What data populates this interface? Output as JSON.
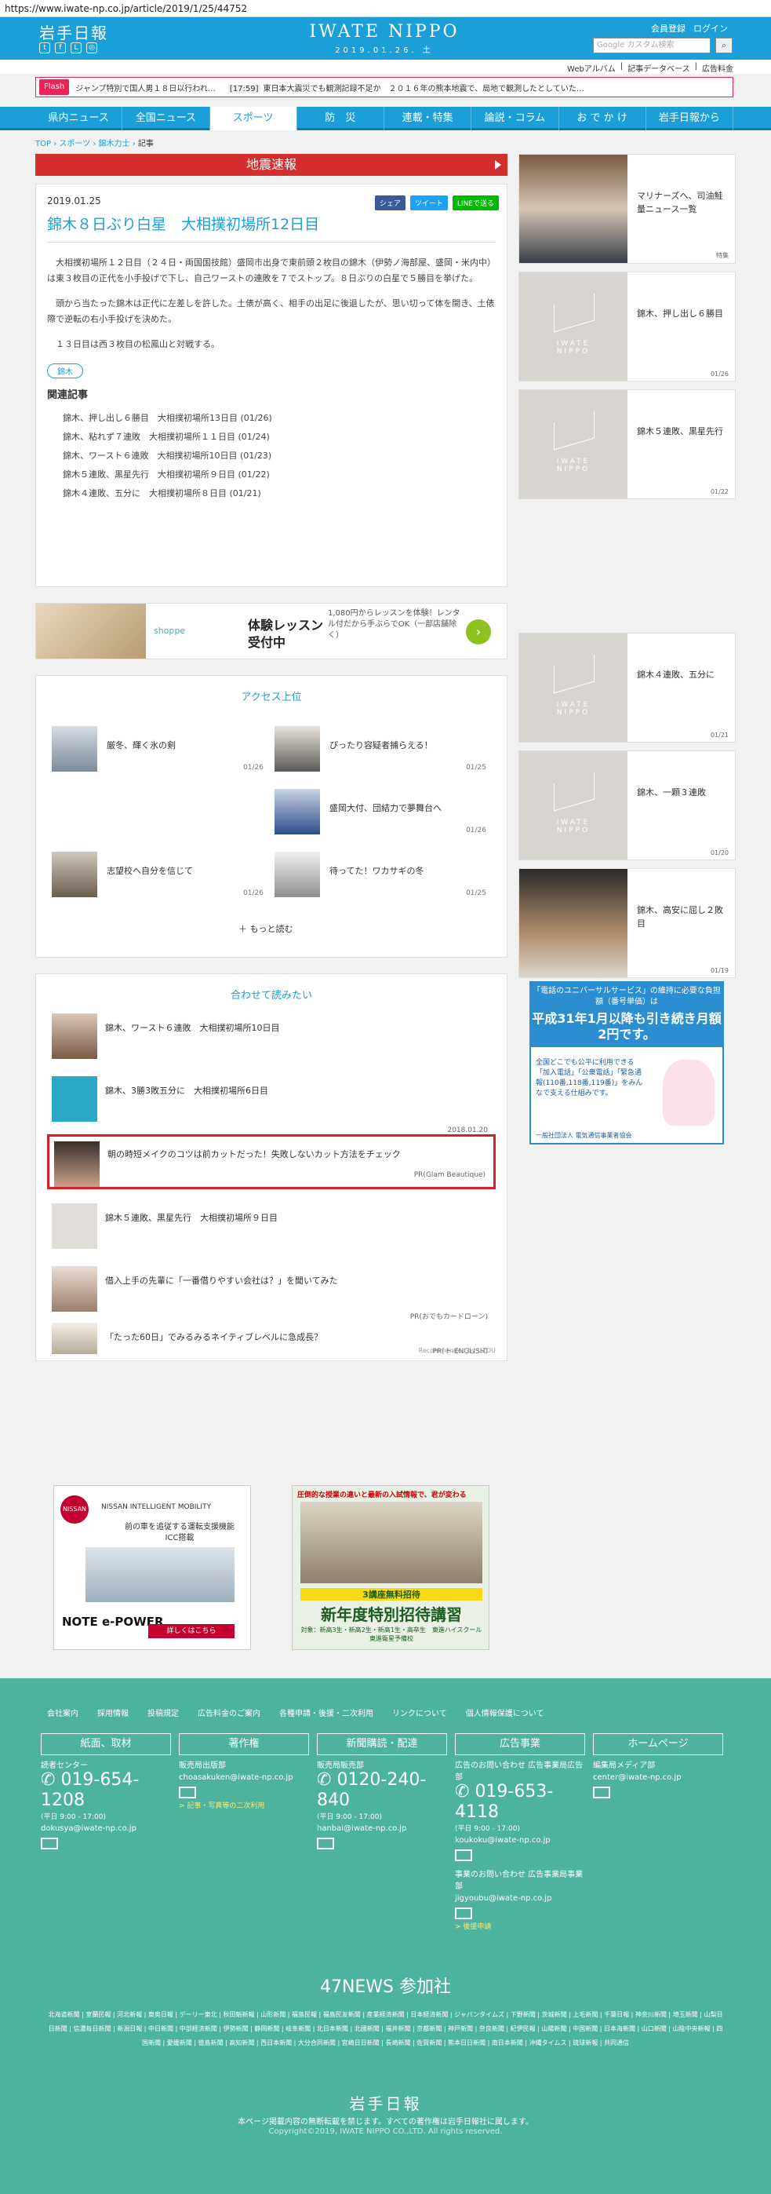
{
  "url": "https://www.iwate-np.co.jp/article/2019/1/25/44752",
  "header": {
    "logo_jp": "岩手日報",
    "brand": "IWATE NIPPO",
    "date": "2019.01.26. 土",
    "links": [
      "会員登録",
      "ログイン"
    ],
    "search_placeholder": "Google カスタム検索",
    "subnav": [
      "Webアルバム",
      "記事データベース",
      "広告料金"
    ],
    "social": [
      "twitter-icon",
      "facebook-icon",
      "line-icon",
      "instagram-icon"
    ]
  },
  "ticker": {
    "flash": "Flash",
    "items": [
      {
        "time": "",
        "text": "ジャンプ特別で国人男１８日以行われ…"
      },
      {
        "time": "[17:59]",
        "text": "東日本大震災でも観測記録不足か　２０１６年の熊本地震で、局地で観測したとしていた…"
      }
    ]
  },
  "nav": [
    "県内ニュース",
    "全国ニュース",
    "スポーツ",
    "防　災",
    "連載・特集",
    "論説・コラム",
    "お で か け",
    "岩手日報から"
  ],
  "breadcrumb": [
    "TOP",
    "スポーツ",
    "錦木力士",
    "記事"
  ],
  "quake_label": "地震速報",
  "article": {
    "date": "2019.01.25",
    "share": [
      "シェア",
      "ツイート",
      "LINEで送る"
    ],
    "title": "錦木８日ぶり白星　大相撲初場所12日目",
    "paragraphs": [
      "大相撲初場所１２日目（２４日・両国国技館）盛岡市出身で東前頭２枚目の錦木（伊勢ノ海部屋、盛岡・米内中）は東３枚目の正代を小手投げで下し、自己ワーストの連敗を７でストップ。８日ぶりの白星で５勝目を挙げた。",
      "頭から当たった錦木は正代に左差しを許した。土俵が高く、相手の出足に後退したが、思い切って体を開き、土俵際で逆転の右小手投げを決めた。",
      "１３日目は西３枚目の松鳳山と対戦する。"
    ],
    "tag": "錦木",
    "related_heading": "関連記事",
    "related": [
      "錦木、押し出し６勝目　大相撲初場所13日目 (01/26)",
      "錦木、粘れず７連敗　大相撲初場所１１日目 (01/24)",
      "錦木、ワースト６連敗　大相撲初場所10日目 (01/23)",
      "錦木５連敗、黒星先行　大相撲初場所９日目 (01/22)",
      "錦木４連敗、五分に　大相撲初場所８日目 (01/21)"
    ]
  },
  "ad_banner": {
    "title1": "体験レッスン",
    "title2": "受付中",
    "desc": "1,080円からレッスンを体験！レンタル付だから手ぶらでOK（一部店舗除く）",
    "brand": "shoppe"
  },
  "access": {
    "heading": "アクセス上位",
    "items": [
      {
        "title": "厳冬、輝く氷の剣",
        "date": "01/26"
      },
      {
        "title": "ぴったり容疑者捕らえる！",
        "date": "01/25"
      },
      {
        "title": "盛岡大付、団結力で夢舞台へ",
        "date": "01/26"
      },
      {
        "title": "志望校へ自分を信じて",
        "date": "01/26"
      },
      {
        "title": "待ってた！ワカサギの冬",
        "date": "01/25"
      }
    ],
    "more": "もっと読む"
  },
  "readmore": {
    "heading": "合わせて読みたい",
    "items": [
      {
        "title": "錦木、ワースト６連敗　大相撲初場所10日目",
        "meta": ""
      },
      {
        "title": "錦木、3勝3敗五分に　大相撲初場所6日目",
        "meta": "2018.01.20"
      },
      {
        "title": "朝の時短メイクのコツは前カットだった！失敗しないカット方法をチェック",
        "meta": "PR(Glam Beautique)"
      },
      {
        "title": "錦木５連敗、黒星先行　大相撲初場所９日目",
        "meta": ""
      },
      {
        "title": "借入上手の先輩に「一番借りやすい会社は？」を聞いてみた",
        "meta": "PR(おでもカードローン)"
      },
      {
        "title": "「たった60日」でみるみるネイティブレベルに急成長？",
        "meta": "PR(ト-ENGLISH)"
      }
    ],
    "recommended_by": "Recommended by UZOU"
  },
  "right_cards": [
    {
      "title": "マリナーズへ、司油鮭量ニュース一覧",
      "date": "特集"
    },
    {
      "title": "錦木、押し出し６勝目",
      "date": "01/26"
    },
    {
      "title": "錦木５連敗、黒星先行",
      "date": "01/22"
    },
    {
      "title": "錦木４連敗、五分に",
      "date": "01/21"
    },
    {
      "title": "錦木、一顆３連敗",
      "date": "01/20"
    },
    {
      "title": "錦木、高安に屈し２敗目",
      "date": "01/19"
    }
  ],
  "notice": {
    "top": "「電話のユニバーサルサービス」の維持に必要な負担額（番号単価）は",
    "big": "平成31年1月以降も引き続き月額2円です。",
    "small": "全国どこでも公平に利用できる「加入電話」「公衆電話」「緊急通報(110番,118番,119番)」をみんなで支える仕組みです。",
    "foot": "一般社団法人 電気通信事業者協会"
  },
  "bottom_ads": {
    "nissan": {
      "logo": "NISSAN",
      "l1": "NISSAN INTELLIGENT MOBILITY",
      "l2": "前の車を追従する運転支援機能 ICC搭載",
      "l3": "NOTE e-POWER",
      "btn": "詳しくはこちら"
    },
    "juku": {
      "t1": "圧倒的な授業の違いと最新の入試情報で、君が変わる",
      "t2": "3講座無料招待",
      "t3": "新年度特別招待講習",
      "t4": "対象：新高3生・新高2生・新高1生・高卒生　東進ハイスクール　東進衛星予備校"
    }
  },
  "footer": {
    "links": [
      "会社案内",
      "採用情報",
      "投稿規定",
      "広告料金のご案内",
      "各種申請・後援・二次利用",
      "リンクについて",
      "個人情報保護について"
    ],
    "cols": [
      {
        "head": "紙面、取材",
        "label": "読者センター",
        "tel": "019-654-1208",
        "hours": "(平日 9:00 - 17:00)",
        "mail": "dokusya@iwate-np.co.jp",
        "link": ""
      },
      {
        "head": "著作権",
        "label": "販売局出版部",
        "tel": "",
        "hours": "",
        "mail": "choasakuken@iwate-np.co.jp",
        "link": "> 記事・写真等の二次利用"
      },
      {
        "head": "新聞購読・配達",
        "label": "販売局販売部",
        "tel": "0120-240-840",
        "hours": "(平日 9:00 - 17:00)",
        "mail": "hanbai@iwate-np.co.jp",
        "link": ""
      },
      {
        "head": "広告事業",
        "label": "広告のお問い合わせ 広告事業局広告部",
        "tel": "019-653-4118",
        "hours": "(平日 9:00 - 17:00)",
        "mail": "koukoku@iwate-np.co.jp",
        "link": "> 後援申請"
      },
      {
        "head": "ホームページ",
        "label": "編集局メディア部",
        "tel": "",
        "hours": "",
        "mail": "center@iwate-np.co.jp",
        "link": ""
      }
    ],
    "extra": {
      "label": "事業のお問い合わせ 広告事業局事業部",
      "mail": "jigyoubu@iwate-np.co.jp"
    },
    "news47": "47NEWS 参加社",
    "news47_list": "北海道新聞 | 室蘭民報 | 河北新報 | 東奥日報 | デーリー東北 | 秋田魁新報 | 山形新聞 | 福島民報 | 福島民友新聞 | 産業経済新聞 | 日本経済新聞 | ジャパンタイムズ | 下野新聞 | 茨城新聞 | 上毛新聞 | 千葉日報 | 神奈川新聞 | 埼玉新聞 | 山梨日日新聞 | 信濃毎日新聞 | 新潟日報 | 中日新聞 | 中部経済新聞 | 伊勢新聞 | 静岡新聞 | 岐阜新聞 | 北日本新聞 | 北國新聞 | 福井新聞 | 京都新聞 | 神戸新聞 | 奈良新聞 | 紀伊民報 | 山陽新聞 | 中国新聞 | 日本海新聞 | 山口新聞 | 山陰中央新報 | 四国新聞 | 愛媛新聞 | 徳島新聞 | 高知新聞 | 西日本新聞 | 大分合同新聞 | 宮崎日日新聞 | 長崎新聞 | 佐賀新聞 | 熊本日日新聞 | 南日本新聞 | 沖縄タイムス | 琉球新報 | 共同通信",
    "logo": "岩手日報",
    "note": "本ページ掲載内容の無断転載を禁じます。すべての著作権は岩手日報社に属します。",
    "copyright": "Copyright©2019, IWATE NIPPO CO.,LTD. All rights reserved."
  }
}
